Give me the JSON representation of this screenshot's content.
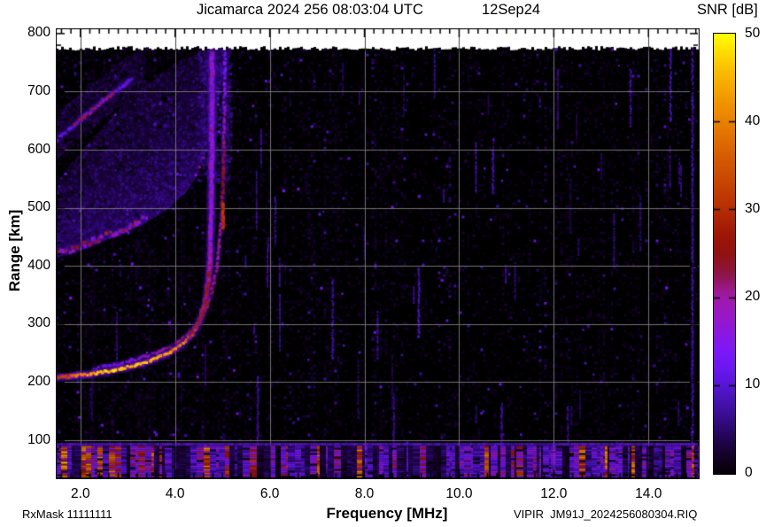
{
  "header": {
    "title_left": "Jicamarca 2024 256 08:03:04 UTC",
    "title_date": "12Sep24"
  },
  "colorbar": {
    "title": "SNR [dB]",
    "min": 0,
    "max": 50,
    "tick_values": [
      50,
      40,
      30,
      20,
      10,
      0
    ],
    "tick_labels": [
      "50",
      "40",
      "30",
      "20",
      "10",
      "0"
    ]
  },
  "axes": {
    "x": {
      "label": "Frequency [MHz]",
      "min": 1.48,
      "max": 15.08,
      "tick_values": [
        2,
        4,
        6,
        8,
        10,
        12,
        14
      ],
      "tick_labels": [
        "2.0",
        "4.0",
        "6.0",
        "8.0",
        "10.0",
        "12.0",
        "14.0"
      ],
      "minor_step": 0.2
    },
    "y": {
      "label": "Range [km]",
      "min": 33,
      "max": 809,
      "tick_values": [
        800,
        700,
        600,
        500,
        400,
        300,
        200,
        100
      ],
      "tick_labels": [
        "800",
        "700",
        "600",
        "500",
        "400",
        "300",
        "200",
        "100"
      ],
      "minor_step": 20
    }
  },
  "footer": {
    "rx_mask": "RxMask 11111111",
    "file": "VIPIR  JM91J_2024256080304.RIQ"
  },
  "chart_data": {
    "type": "heatmap",
    "title": "Jicamarca 2024 256 08:03:04 UTC",
    "xlabel": "Frequency [MHz]",
    "ylabel": "Range [km]",
    "zlabel": "SNR [dB]",
    "xlim": [
      1.48,
      15.08
    ],
    "ylim": [
      33,
      809
    ],
    "zlim": [
      0,
      50
    ],
    "grid": true,
    "grid_x_step": 2,
    "grid_y_step": 100,
    "data_top_km": 770,
    "colormap_stops": [
      [
        0,
        "#050007"
      ],
      [
        2,
        "#140227"
      ],
      [
        4,
        "#230552"
      ],
      [
        6,
        "#340b84"
      ],
      [
        8,
        "#4511ae"
      ],
      [
        10,
        "#5615d5"
      ],
      [
        12,
        "#6b17f1"
      ],
      [
        14,
        "#7d18f8"
      ],
      [
        16,
        "#8c17e1"
      ],
      [
        18,
        "#9818c5"
      ],
      [
        20,
        "#a01aaa"
      ],
      [
        21,
        "#9c1887"
      ],
      [
        22,
        "#92165f"
      ],
      [
        23,
        "#8d143e"
      ],
      [
        25,
        "#911211"
      ],
      [
        27,
        "#9c1507"
      ],
      [
        30,
        "#b52d03"
      ],
      [
        33,
        "#c64503"
      ],
      [
        36,
        "#d55c00"
      ],
      [
        40,
        "#e98000"
      ],
      [
        43,
        "#f29c00"
      ],
      [
        46,
        "#fbbf00"
      ],
      [
        48,
        "#ffdd00"
      ],
      [
        50,
        "#ffff06"
      ]
    ],
    "traces": {
      "f1_o": {
        "points": [
          [
            1.48,
            208
          ],
          [
            1.8,
            210
          ],
          [
            2.2,
            214
          ],
          [
            2.6,
            219
          ],
          [
            3.0,
            226
          ],
          [
            3.4,
            235
          ],
          [
            3.7,
            244
          ],
          [
            3.95,
            254
          ],
          [
            4.15,
            266
          ],
          [
            4.35,
            282
          ],
          [
            4.5,
            302
          ],
          [
            4.62,
            330
          ],
          [
            4.7,
            368
          ],
          [
            4.745,
            425
          ],
          [
            4.765,
            505
          ],
          [
            4.775,
            610
          ],
          [
            4.78,
            770
          ]
        ],
        "snr_profile": [
          [
            1.48,
            30
          ],
          [
            1.9,
            38
          ],
          [
            2.3,
            44
          ],
          [
            2.6,
            47
          ],
          [
            3.6,
            46
          ],
          [
            4.0,
            41
          ],
          [
            4.3,
            36
          ],
          [
            4.55,
            30
          ],
          [
            4.7,
            24
          ],
          [
            4.78,
            13
          ]
        ],
        "critical_frequency_mhz": 4.78
      },
      "f1_x": {
        "points": [
          [
            2.3,
            224
          ],
          [
            2.8,
            232
          ],
          [
            3.2,
            240
          ],
          [
            3.6,
            250
          ],
          [
            3.9,
            261
          ],
          [
            4.15,
            274
          ],
          [
            4.4,
            292
          ],
          [
            4.6,
            315
          ],
          [
            4.75,
            345
          ],
          [
            4.87,
            390
          ],
          [
            4.95,
            450
          ],
          [
            5.01,
            530
          ],
          [
            5.04,
            640
          ],
          [
            5.055,
            770
          ]
        ],
        "snr_profile": [
          [
            2.3,
            12
          ],
          [
            3.0,
            16
          ],
          [
            3.6,
            18
          ],
          [
            4.1,
            22
          ],
          [
            4.5,
            24
          ],
          [
            4.8,
            22
          ],
          [
            4.95,
            20
          ],
          [
            5.02,
            26
          ],
          [
            5.055,
            12
          ]
        ],
        "bright_dash": {
          "f": 5.02,
          "km": [
            465,
            508
          ],
          "snr": 30
        },
        "critical_frequency_mhz": 5.06
      },
      "f2_spread": {
        "lower": [
          [
            1.48,
            416
          ],
          [
            1.8,
            424
          ],
          [
            2.1,
            432
          ],
          [
            2.4,
            442
          ],
          [
            2.7,
            452
          ],
          [
            3.0,
            462
          ],
          [
            3.3,
            474
          ],
          [
            3.6,
            488
          ],
          [
            3.9,
            505
          ],
          [
            4.2,
            528
          ],
          [
            4.45,
            558
          ],
          [
            4.65,
            600
          ],
          [
            4.8,
            650
          ],
          [
            4.95,
            715
          ],
          [
            5.05,
            770
          ]
        ],
        "upper": [
          [
            1.48,
            545
          ],
          [
            1.8,
            575
          ],
          [
            2.1,
            605
          ],
          [
            2.4,
            632
          ],
          [
            2.7,
            658
          ],
          [
            3.0,
            682
          ],
          [
            3.3,
            704
          ],
          [
            3.6,
            724
          ],
          [
            3.9,
            742
          ],
          [
            4.2,
            757
          ],
          [
            4.5,
            768
          ],
          [
            4.8,
            772
          ],
          [
            5.05,
            772
          ]
        ],
        "core_f_range": [
          1.52,
          3.45
        ],
        "core_snr": [
          14,
          30
        ]
      },
      "f3_hop": {
        "points": [
          [
            1.48,
            616
          ],
          [
            1.75,
            634
          ],
          [
            2.0,
            652
          ],
          [
            2.3,
            672
          ],
          [
            2.6,
            692
          ],
          [
            2.9,
            710
          ],
          [
            3.1,
            722
          ]
        ],
        "core_f_range": [
          1.85,
          2.7
        ],
        "core_snr": [
          20,
          28
        ]
      }
    },
    "rfi_segments": [
      {
        "f": 5.75,
        "km": [
          95,
          210
        ],
        "snr": 8
      },
      {
        "f": 6.12,
        "km": [
          438,
          520
        ],
        "snr": 7
      },
      {
        "f": 7.33,
        "km": [
          240,
          378
        ],
        "snr": 9
      },
      {
        "f": 8.62,
        "km": [
          95,
          180
        ],
        "snr": 7
      },
      {
        "f": 9.15,
        "km": [
          282,
          398
        ],
        "snr": 10
      },
      {
        "f": 10.72,
        "km": [
          525,
          620
        ],
        "snr": 9
      },
      {
        "f": 10.9,
        "km": [
          95,
          165
        ],
        "snr": 8
      },
      {
        "f": 12.3,
        "km": [
          92,
          160
        ],
        "snr": 7
      },
      {
        "f": 13.62,
        "km": [
          640,
          740
        ],
        "snr": 8
      },
      {
        "f": 14.47,
        "km": [
          650,
          780
        ],
        "snr": 9
      },
      {
        "f": 14.93,
        "km": [
          40,
          782
        ],
        "snr": 9
      }
    ],
    "noise_band": {
      "km_range": [
        33,
        92
      ],
      "snr_range": [
        0,
        33
      ]
    }
  }
}
